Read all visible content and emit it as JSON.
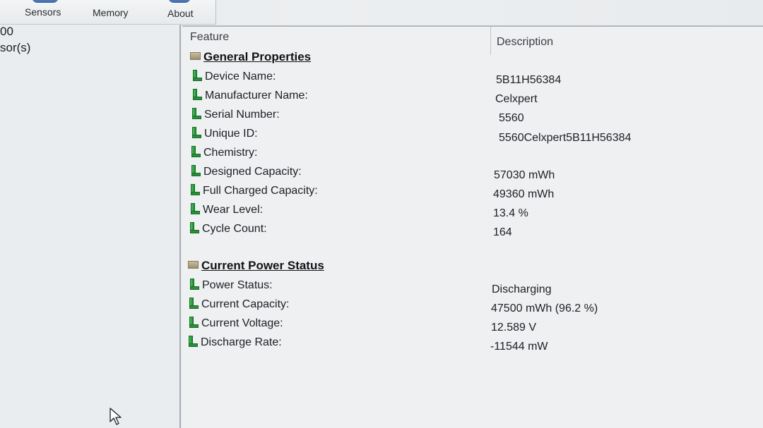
{
  "toolbar": {
    "tabs": [
      "Sensors",
      "Memory",
      "About"
    ]
  },
  "left_pane": {
    "items": [
      "00",
      "sor(s)"
    ]
  },
  "table": {
    "headers": {
      "feature": "Feature",
      "description": "Description"
    },
    "sections": [
      {
        "title": "General Properties",
        "rows": [
          {
            "feature": "Device Name:",
            "value": "5B11H56384"
          },
          {
            "feature": "Manufacturer Name:",
            "value": "Celxpert"
          },
          {
            "feature": "Serial Number:",
            "value": "5560"
          },
          {
            "feature": "Unique ID:",
            "value": "5560Celxpert5B11H56384"
          },
          {
            "feature": "Chemistry:",
            "value": ""
          },
          {
            "feature": "Designed Capacity:",
            "value": "57030 mWh"
          },
          {
            "feature": "Full Charged Capacity:",
            "value": "49360 mWh"
          },
          {
            "feature": "Wear Level:",
            "value": "13.4 %"
          },
          {
            "feature": "Cycle Count:",
            "value": "164"
          }
        ]
      },
      {
        "title": "Current Power Status",
        "rows": [
          {
            "feature": "Power Status:",
            "value": "Discharging"
          },
          {
            "feature": "Current Capacity:",
            "value": "47500 mWh (96.2 %)"
          },
          {
            "feature": "Current Voltage:",
            "value": "12.589 V"
          },
          {
            "feature": "Discharge Rate:",
            "value": "-11544 mW"
          }
        ]
      }
    ]
  },
  "colors": {
    "leaf_icon": "#2c8f3a",
    "section_icon": "#b3a886",
    "toolbar_icon": "#3d67a8"
  }
}
